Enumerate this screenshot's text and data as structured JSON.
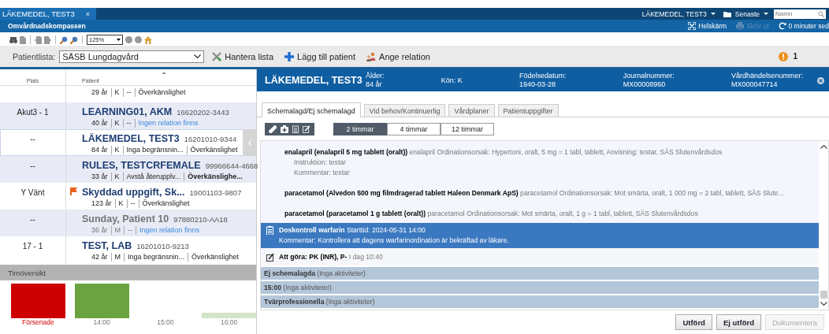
{
  "app_bar": {
    "tab": {
      "label": "LÄKEMEDEL, TEST3",
      "close": "×"
    },
    "user_menu": "LÄKEMEDEL, TEST3",
    "recent_menu": "Senaste",
    "search": {
      "placeholder": "Namn"
    }
  },
  "sub_bar": {
    "title": "Omvårdnadskompassen",
    "actions": [
      {
        "kind": "fullscreen",
        "label": "Helskärm",
        "disabled": false
      },
      {
        "kind": "print",
        "label": "Skriv ut",
        "disabled": true
      },
      {
        "kind": "refresh",
        "label": "0 minuter sed",
        "disabled": false
      }
    ]
  },
  "toolbar": {
    "zoom": "125%"
  },
  "list_bar": {
    "label": "Patientlista:",
    "value": "SÄSB Lungdagvård",
    "actions": [
      {
        "kind": "manage",
        "label": "Hantera lista"
      },
      {
        "kind": "add",
        "label": "Lägg till patient"
      },
      {
        "kind": "relation",
        "label": "Ange relation"
      }
    ],
    "alerts": "1"
  },
  "patient_list": {
    "columns": [
      "Plats",
      "Patient"
    ],
    "rows": [
      {
        "place": "",
        "name": "",
        "pnr": "",
        "flagged": false,
        "dimmed": false,
        "selected": false,
        "meta": [
          {
            "text": "29 år",
            "kind": "plain"
          },
          {
            "text": "K",
            "kind": "plain"
          },
          {
            "text": "--",
            "kind": "plain"
          },
          {
            "text": "Överkänslighet",
            "kind": "plain"
          }
        ]
      },
      {
        "place": "Akut3 - 1",
        "name": "LEARNING01, AKM",
        "pnr": "16620202-3443",
        "flagged": false,
        "dimmed": false,
        "selected": false,
        "meta": [
          {
            "text": "40 år",
            "kind": "plain"
          },
          {
            "text": "K",
            "kind": "plain"
          },
          {
            "text": "--",
            "kind": "plain"
          },
          {
            "text": "Ingen relation finns",
            "kind": "link"
          }
        ]
      },
      {
        "place": "--",
        "name": "LÄKEMEDEL, TEST3",
        "pnr": "16201010-9344",
        "flagged": false,
        "dimmed": false,
        "selected": true,
        "meta": [
          {
            "text": "84 år",
            "kind": "plain"
          },
          {
            "text": "K",
            "kind": "plain"
          },
          {
            "text": "Inga begränsnin...",
            "kind": "plain"
          },
          {
            "text": "Överkänslighet",
            "kind": "plain"
          }
        ]
      },
      {
        "place": "--",
        "name": "RULES, TESTCRFEMALE",
        "pnr": "99966644-4668",
        "flagged": false,
        "dimmed": false,
        "selected": false,
        "meta": [
          {
            "text": "33 år",
            "kind": "plain"
          },
          {
            "text": "K",
            "kind": "plain"
          },
          {
            "text": "Avstå återupplv...",
            "kind": "plain"
          },
          {
            "text": "Överkänslighe...",
            "kind": "bold"
          }
        ]
      },
      {
        "place": "Y Vänt",
        "name": "Skyddad uppgift, Sk...",
        "pnr": "19001103-9807",
        "flagged": true,
        "dimmed": false,
        "selected": false,
        "meta": [
          {
            "text": "123 år",
            "kind": "plain"
          },
          {
            "text": "K",
            "kind": "plain"
          },
          {
            "text": "--",
            "kind": "plain"
          },
          {
            "text": "Överkänslighet",
            "kind": "plain"
          }
        ]
      },
      {
        "place": "--",
        "name": "Sunday, Patient 10",
        "pnr": "97880210-AA18",
        "flagged": false,
        "dimmed": true,
        "selected": false,
        "meta": [
          {
            "text": "36 år",
            "kind": "plain"
          },
          {
            "text": "M",
            "kind": "plain"
          },
          {
            "text": "--",
            "kind": "plain"
          },
          {
            "text": "Ingen relation finns",
            "kind": "link"
          }
        ]
      },
      {
        "place": "17 - 1",
        "name": "TEST, LAB",
        "pnr": "16201010-9213",
        "flagged": false,
        "dimmed": false,
        "selected": false,
        "meta": [
          {
            "text": "42 år",
            "kind": "plain"
          },
          {
            "text": "M",
            "kind": "plain"
          },
          {
            "text": "Inga begränsnin...",
            "kind": "plain"
          },
          {
            "text": "Överkänslighet",
            "kind": "plain"
          }
        ]
      }
    ]
  },
  "hour_overview": {
    "title": "Timöversikt",
    "columns": [
      {
        "label": "Försenade",
        "kind": "overdue",
        "color": "#cc0000"
      },
      {
        "label": "14:00",
        "kind": "hour",
        "color": "#6aa33f"
      },
      {
        "label": "15:00",
        "kind": "hour"
      },
      {
        "label": "16:00",
        "kind": "hour",
        "color": "#d4e4c6"
      }
    ]
  },
  "patient_panel": {
    "name": "LÄKEMEDEL, TEST3",
    "fields": [
      {
        "kind": "stacked",
        "label": "Ålder:",
        "value": "84 år"
      },
      {
        "kind": "inline",
        "text": "Kön: K"
      },
      {
        "kind": "stacked",
        "label": "Födelsedatum:",
        "value": "1940-03-28"
      },
      {
        "kind": "stacked",
        "label": "Journalnummer:",
        "value": "MX00008960"
      },
      {
        "kind": "stacked",
        "label": "Vårdhändelsenummer:",
        "value": "MX000047714"
      }
    ],
    "tabs": [
      {
        "label": "Schemalagd/Ej schemalagd",
        "selected": true
      },
      {
        "label": "Vid behov/Kontinuerlig",
        "selected": false
      },
      {
        "label": "Vårdplaner",
        "selected": false
      },
      {
        "label": "Patientuppgifter",
        "selected": false
      }
    ],
    "ranges": [
      {
        "label": "2 timmar",
        "selected": true
      },
      {
        "label": "4 timmar",
        "selected": false
      },
      {
        "label": "12 timmar",
        "selected": false
      }
    ],
    "items": [
      {
        "kind": "medication",
        "selected": false,
        "text": "**enalapril (enalapril 5 mg tablett (oralt))** enalapril Ordinationsorsak: Hypertoni, oralt, 5 mg = 1 tabl, tablett, Anvisning: testar, SÄS Slutenvårdsdos",
        "notes": [
          "Instruktion: testar",
          "Kommentar: testar"
        ]
      },
      {
        "kind": "medication",
        "selected": false,
        "text": "**paracetamol (Alvedon 500 mg filmdragerad tablett Haleon Denmark ApS)** paracetamol Ordinationsorsak: Mot smärta, oralt, 1 000 mg = 2 tabl, tablett, SÄS Slute..."
      },
      {
        "kind": "medication",
        "selected": false,
        "text": "**paracetamol (paracetamol 1 g tablett (oralt))** paracetamol Ordinationsorsak: Mot smärta, oralt, 1 g = 1 tabl, tablett, SÄS Slutenvårdsdos"
      },
      {
        "kind": "task",
        "selected": true,
        "text": "**Doskontroll warfarin** Starttid: 2024-05-31 14:00",
        "notes": [
          "Kommentar: Kontrollera att dagens warfarinordination är bekräftad av läkare."
        ]
      },
      {
        "kind": "todo",
        "selected": false,
        "text": "**Att göra: PK (INR), P-** I dag 10:40"
      },
      {
        "kind": "group",
        "selected": false,
        "text": "**Ej schemalagda** (Inga aktiviteter)"
      },
      {
        "kind": "group",
        "selected": false,
        "text": "**15:00** (Inga aktiviteter)"
      },
      {
        "kind": "group",
        "selected": false,
        "text": "**Tvärprofessionella** (Inga aktiviteter)"
      }
    ],
    "buttons": [
      {
        "label": "Utförd",
        "disabled": false
      },
      {
        "label": "Ej utförd",
        "disabled": false
      },
      {
        "label": "Dokumentera",
        "disabled": true
      }
    ]
  }
}
